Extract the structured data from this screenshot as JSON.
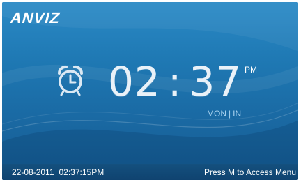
{
  "brand": {
    "logo_text": "ANVIZ"
  },
  "clock": {
    "hours": "02",
    "separator": ":",
    "minutes": "37",
    "period": "PM",
    "status_day": "MON",
    "status_separator": "|",
    "status_mode": "IN"
  },
  "footer": {
    "date": "22-08-2011",
    "time": "02:37:15PM",
    "hint": "Press M to Access Menu"
  },
  "icons": {
    "alarm": "alarm-clock-icon"
  },
  "colors": {
    "background": "#1f79b4",
    "footer": "#124a77",
    "text": "#ffffff",
    "status_text": "#a8d2ef"
  }
}
